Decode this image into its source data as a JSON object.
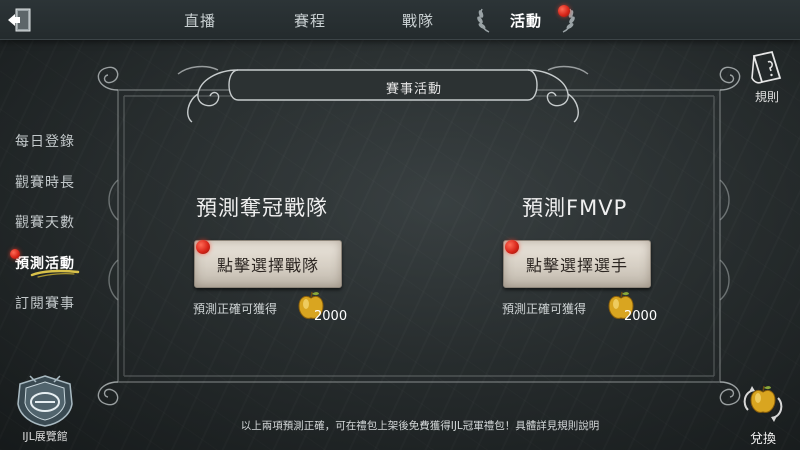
{
  "nav": {
    "tabs": [
      {
        "label": "直播",
        "active": false
      },
      {
        "label": "賽程",
        "active": false
      },
      {
        "label": "戰隊",
        "active": false
      },
      {
        "label": "活動",
        "active": true
      }
    ],
    "exit_icon": "exit-door-icon"
  },
  "sidebar": {
    "items": [
      {
        "label": "每日登錄",
        "active": false
      },
      {
        "label": "觀賽時長",
        "active": false
      },
      {
        "label": "觀賽天數",
        "active": false
      },
      {
        "label": "預測活動",
        "active": true
      },
      {
        "label": "訂閱賽事",
        "active": false
      }
    ],
    "museum_label": "IJL展覽館"
  },
  "panel": {
    "banner_title": "賽事活動",
    "champion": {
      "title": "預測奪冠戰隊",
      "button_label": "點擊選擇戰隊",
      "reward_label": "預測正確可獲得",
      "reward_amount": "2000"
    },
    "fmvp": {
      "title": "預測FMVP",
      "button_label": "點擊選擇選手",
      "reward_label": "預測正確可獲得",
      "reward_amount": "2000"
    },
    "footer_note": "以上兩項預測正確，可在禮包上架後免費獲得IJL冠軍禮包！具體詳見規則說明"
  },
  "right": {
    "rules_label": "規則",
    "exchange_label": "兌換"
  },
  "colors": {
    "background": "#262b2c",
    "notification_dot": "#d8261a",
    "button_face": "#d6cfc4",
    "apple_gold": "#d9a520"
  }
}
